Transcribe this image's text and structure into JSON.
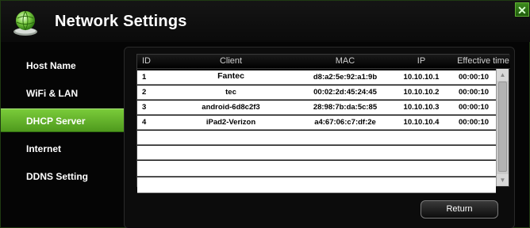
{
  "window": {
    "title": "Network Settings",
    "close_symbol": "✕"
  },
  "sidebar": {
    "items": [
      {
        "label": "Host Name",
        "active": false
      },
      {
        "label": "WiFi & LAN",
        "active": false
      },
      {
        "label": "DHCP Server",
        "active": true
      },
      {
        "label": "Internet",
        "active": false
      },
      {
        "label": "DDNS Setting",
        "active": false
      }
    ]
  },
  "table": {
    "headers": [
      "ID",
      "Client",
      "MAC",
      "IP",
      "Effective time"
    ],
    "rows": [
      [
        "1",
        "Fantec",
        "d8:a2:5e:92:a1:9b",
        "10.10.10.1",
        "00:00:10"
      ],
      [
        "2",
        "tec",
        "00:02:2d:45:24:45",
        "10.10.10.2",
        "00:00:10"
      ],
      [
        "3",
        "android-6d8c2f3",
        "28:98:7b:da:5c:85",
        "10.10.10.3",
        "00:00:10"
      ],
      [
        "4",
        "iPad2-Verizon",
        "a4:67:06:c7:df:2e",
        "10.10.10.4",
        "00:00:10"
      ],
      [
        "",
        "",
        "",
        "",
        ""
      ],
      [
        "",
        "",
        "",
        "",
        ""
      ],
      [
        "",
        "",
        "",
        "",
        ""
      ]
    ]
  },
  "buttons": {
    "return_label": "Return"
  },
  "icons": {
    "app": "network-globe-icon",
    "close": "close-icon"
  },
  "colors": {
    "accent": "#5fae2a",
    "background": "#000000"
  }
}
